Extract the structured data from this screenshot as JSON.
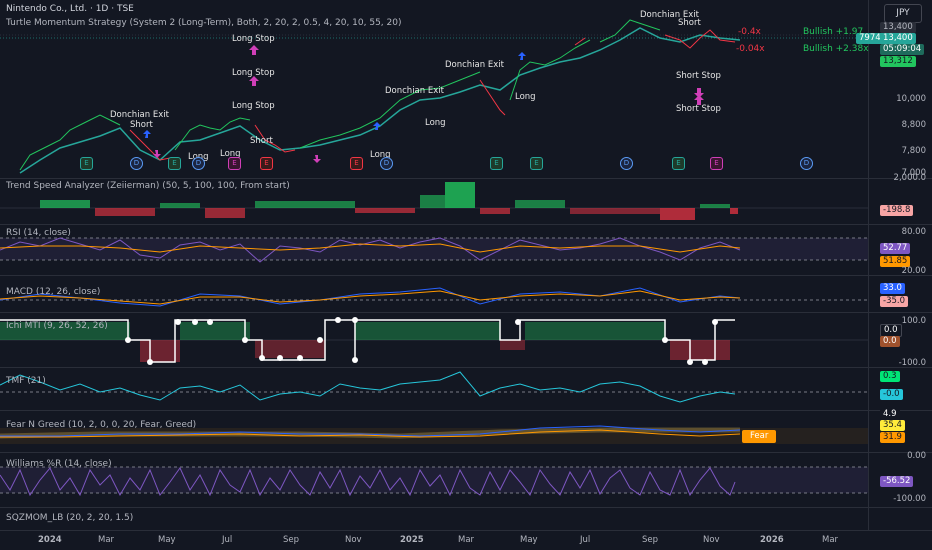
{
  "header": {
    "symbol_line": "Nintendo Co., Ltd. · 1D · TSE",
    "strategy_line": "Turtle Momentum Strategy (System 2 (Long-Term), Both, 2, 20, 2, 0.5, 4, 20, 10, 55, 20)",
    "currency_button": "JPY"
  },
  "price_axis": {
    "ticks": [
      "10,000",
      "8,800",
      "7,800",
      "7,000"
    ],
    "badges": {
      "top": "13,400",
      "symbol": "7974",
      "last": "13,400",
      "countdown": "05:09:04",
      "other": "13,312"
    },
    "bullish_labels": [
      "Bullish +1.97",
      "Bullish +2.38x"
    ],
    "red_labels": [
      "-0.4x",
      "-0.04x"
    ]
  },
  "chart_labels": {
    "long_stop": "Long Stop",
    "short_stop": "Short Stop",
    "donchian_exit": "Donchian Exit",
    "short": "Short",
    "long": "Long"
  },
  "events": [
    {
      "kind": "E",
      "style": "e"
    },
    {
      "kind": "D",
      "style": "d"
    },
    {
      "kind": "E",
      "style": "e"
    },
    {
      "kind": "D",
      "style": "d"
    },
    {
      "kind": "E",
      "style": "ep"
    },
    {
      "kind": "E",
      "style": "er"
    },
    {
      "kind": "E",
      "style": "er"
    },
    {
      "kind": "D",
      "style": "d"
    },
    {
      "kind": "E",
      "style": "e"
    },
    {
      "kind": "E",
      "style": "e"
    },
    {
      "kind": "D",
      "style": "d"
    },
    {
      "kind": "E",
      "style": "e"
    },
    {
      "kind": "E",
      "style": "ep"
    },
    {
      "kind": "D",
      "style": "d"
    }
  ],
  "panes": {
    "trend_speed": {
      "title": "Trend Speed Analyzer (Zeiierman) (50, 5, 100, 100, From start)",
      "tick": "2,000.0",
      "value": "-198.8"
    },
    "rsi": {
      "title": "RSI (14, close)",
      "ticks": [
        "80.00",
        "20.00"
      ],
      "values": [
        "52.77",
        "51.85"
      ]
    },
    "macd": {
      "title": "MACD (12, 26, close)",
      "values": [
        "33.0",
        "-35.0"
      ]
    },
    "ichi": {
      "title": "Ichi MTI (9, 26, 52, 26)",
      "ticks": [
        "100.0",
        "-100.0"
      ],
      "values": [
        "0.0",
        "0.0"
      ]
    },
    "tmf": {
      "title": "TMF (21)",
      "values": [
        "0.3",
        "-0.0"
      ]
    },
    "fear_greed": {
      "title": "Fear N Greed (10, 2, 0, 0, 20, Fear, Greed)",
      "values": [
        "4.9",
        "35.4",
        "31.9"
      ],
      "badge": "Fear"
    },
    "williams": {
      "title": "Williams %R (14, close)",
      "ticks": [
        "0.00",
        "-100.00"
      ],
      "value": "-56.52"
    },
    "sqzmom": {
      "title": "SQZMOM_LB (20, 2, 20, 1.5)"
    }
  },
  "time_axis": [
    "2024",
    "Mar",
    "May",
    "Jul",
    "Sep",
    "Nov",
    "2025",
    "Mar",
    "May",
    "Jul",
    "Sep",
    "Nov",
    "2026",
    "Mar"
  ],
  "colors": {
    "background": "#131722",
    "green": "#26a69a",
    "bright_green": "#22c55e",
    "red": "#f23645",
    "purple": "#7e57c2",
    "orange": "#ff9800",
    "blue": "#2962ff",
    "magenta": "#d03fb8"
  }
}
